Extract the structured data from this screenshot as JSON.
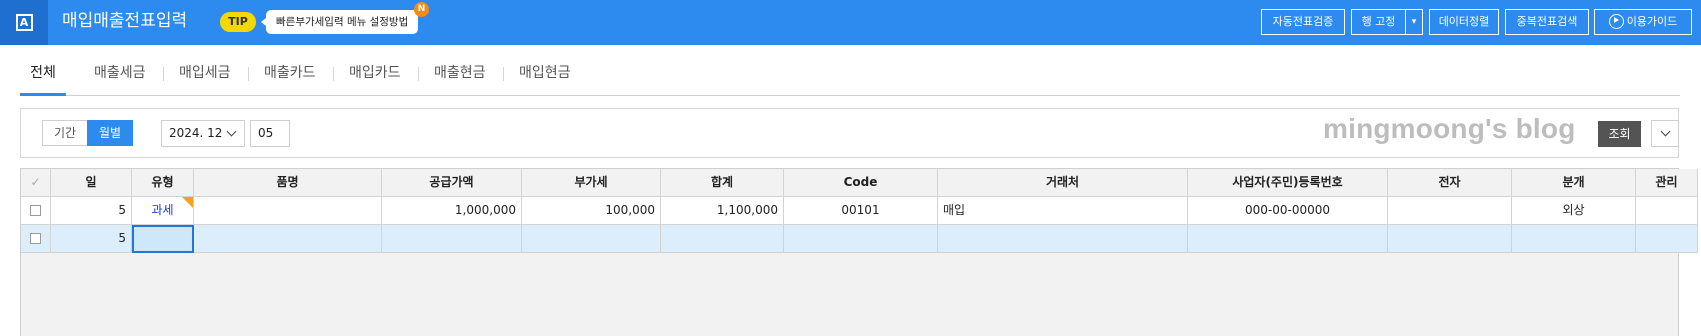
{
  "header": {
    "logo_icon": "document-a-icon",
    "logo_letter": "A",
    "title": "매입매출전표입력",
    "tip_label": "TIP",
    "tip_text": "빠른부가세입력 메뉴 설정방법",
    "new_badge": "N",
    "buttons": {
      "auto_verify": "자동전표검증",
      "row_fix": "행 고정",
      "data_sort": "데이터정렬",
      "dup_search": "중복전표검색",
      "guide": "이용가이드"
    }
  },
  "tabs": [
    {
      "label": "전체",
      "active": true
    },
    {
      "label": "매출세금",
      "active": false
    },
    {
      "label": "매입세금",
      "active": false
    },
    {
      "label": "매출카드",
      "active": false
    },
    {
      "label": "매입카드",
      "active": false
    },
    {
      "label": "매출현금",
      "active": false
    },
    {
      "label": "매입현금",
      "active": false
    }
  ],
  "filter": {
    "period_label": "기간",
    "monthly_label": "월별",
    "month_value": "2024. 12",
    "day_value": "05",
    "watermark": "mingmoong's blog",
    "search_label": "조회"
  },
  "grid": {
    "columns": [
      "일",
      "유형",
      "품명",
      "공급가액",
      "부가세",
      "합계",
      "Code",
      "거래처",
      "사업자(주민)등록번호",
      "전자",
      "분개",
      "관리"
    ],
    "header_check": "✓",
    "rows": [
      {
        "day": "5",
        "type": "과세",
        "item": "",
        "supply": "1,000,000",
        "vat": "100,000",
        "total": "1,100,000",
        "code": "00101",
        "vendor": "매입",
        "reg_no": "000-00-00000",
        "electronic": "",
        "journal": "외상",
        "manage": "",
        "flag": "N"
      },
      {
        "day": "5",
        "type": "",
        "item": "",
        "supply": "",
        "vat": "",
        "total": "",
        "code": "",
        "vendor": "",
        "reg_no": "",
        "electronic": "",
        "journal": "",
        "manage": ""
      }
    ]
  },
  "colors": {
    "header_bg": "#2d8bf0",
    "logo_bg": "#1f6fd1",
    "tip_yellow": "#f5d800",
    "new_orange": "#f28c1b",
    "selected_row": "#dceefb"
  }
}
